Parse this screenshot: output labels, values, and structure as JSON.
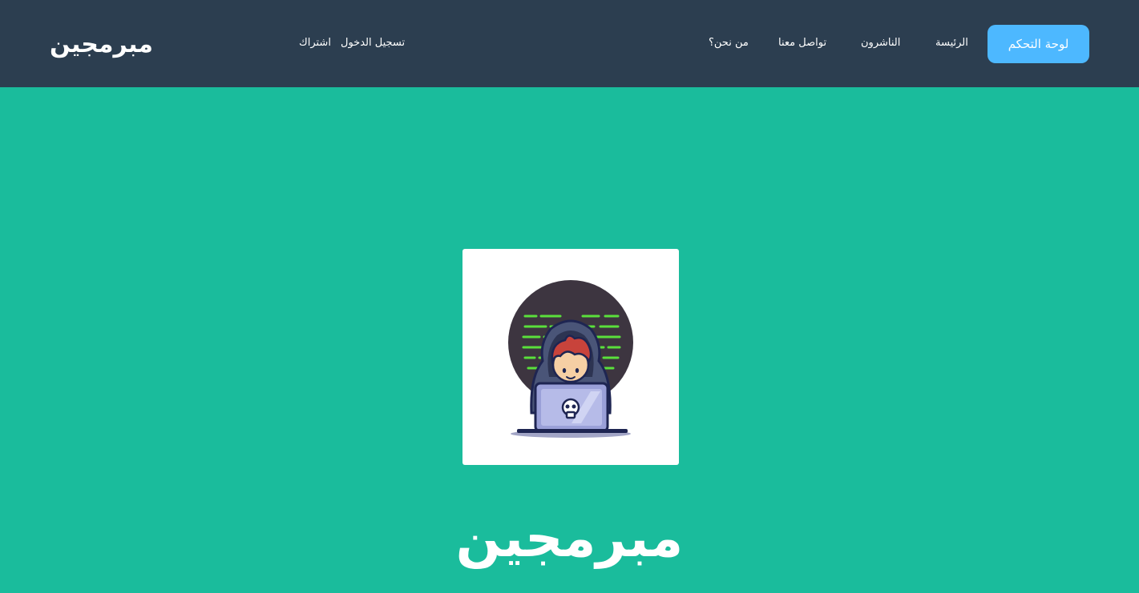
{
  "navbar": {
    "brand": "مبرمجين",
    "auth": {
      "login": "تسجيل الدخول",
      "signup": "اشتراك"
    },
    "links": {
      "home": "الرئيسة",
      "publishers": "الناشرون",
      "contact": "تواصل معنا",
      "about": "من نحن؟"
    },
    "dashboard_button": "لوحة التحكم"
  },
  "hero": {
    "title": "مبرمجين",
    "image_icon": "hooded-programmer-laptop-icon"
  },
  "colors": {
    "navbar": "#2c3e50",
    "hero_background": "#1abc9c",
    "dashboard_button": "#4db8ff",
    "text": "#ffffff"
  }
}
